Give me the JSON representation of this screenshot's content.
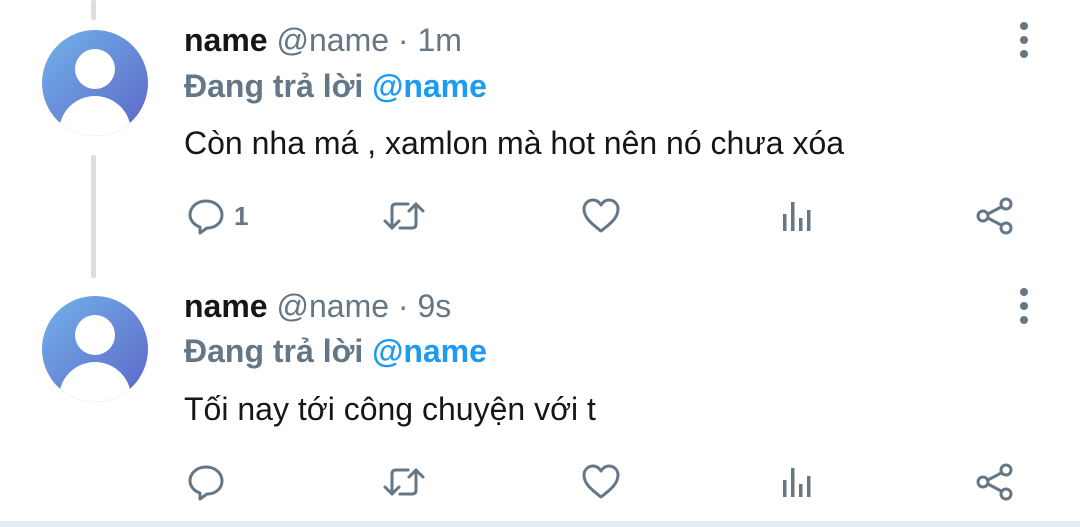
{
  "tweets": [
    {
      "name": "name",
      "handle": "@name",
      "separator": "·",
      "time": "1m",
      "replying_prefix": "Đang trả lời",
      "replying_to": "@name",
      "text": "Còn nha má , xamlon mà hot nên nó chưa xóa",
      "reply_count": "1"
    },
    {
      "name": "name",
      "handle": "@name",
      "separator": "·",
      "time": "9s",
      "replying_prefix": "Đang trả lời",
      "replying_to": "@name",
      "text": "Tối nay tới công chuyện với t",
      "reply_count": ""
    }
  ],
  "icons": {
    "reply": "reply-icon",
    "retweet": "retweet-icon",
    "like": "heart-icon",
    "analytics": "analytics-icon",
    "share": "share-icon",
    "more": "more-vertical-icon"
  },
  "colors": {
    "primary_text": "#14171a",
    "secondary_text": "#657786",
    "mention": "#1d9bf0",
    "thread_line": "#dcdde0"
  }
}
